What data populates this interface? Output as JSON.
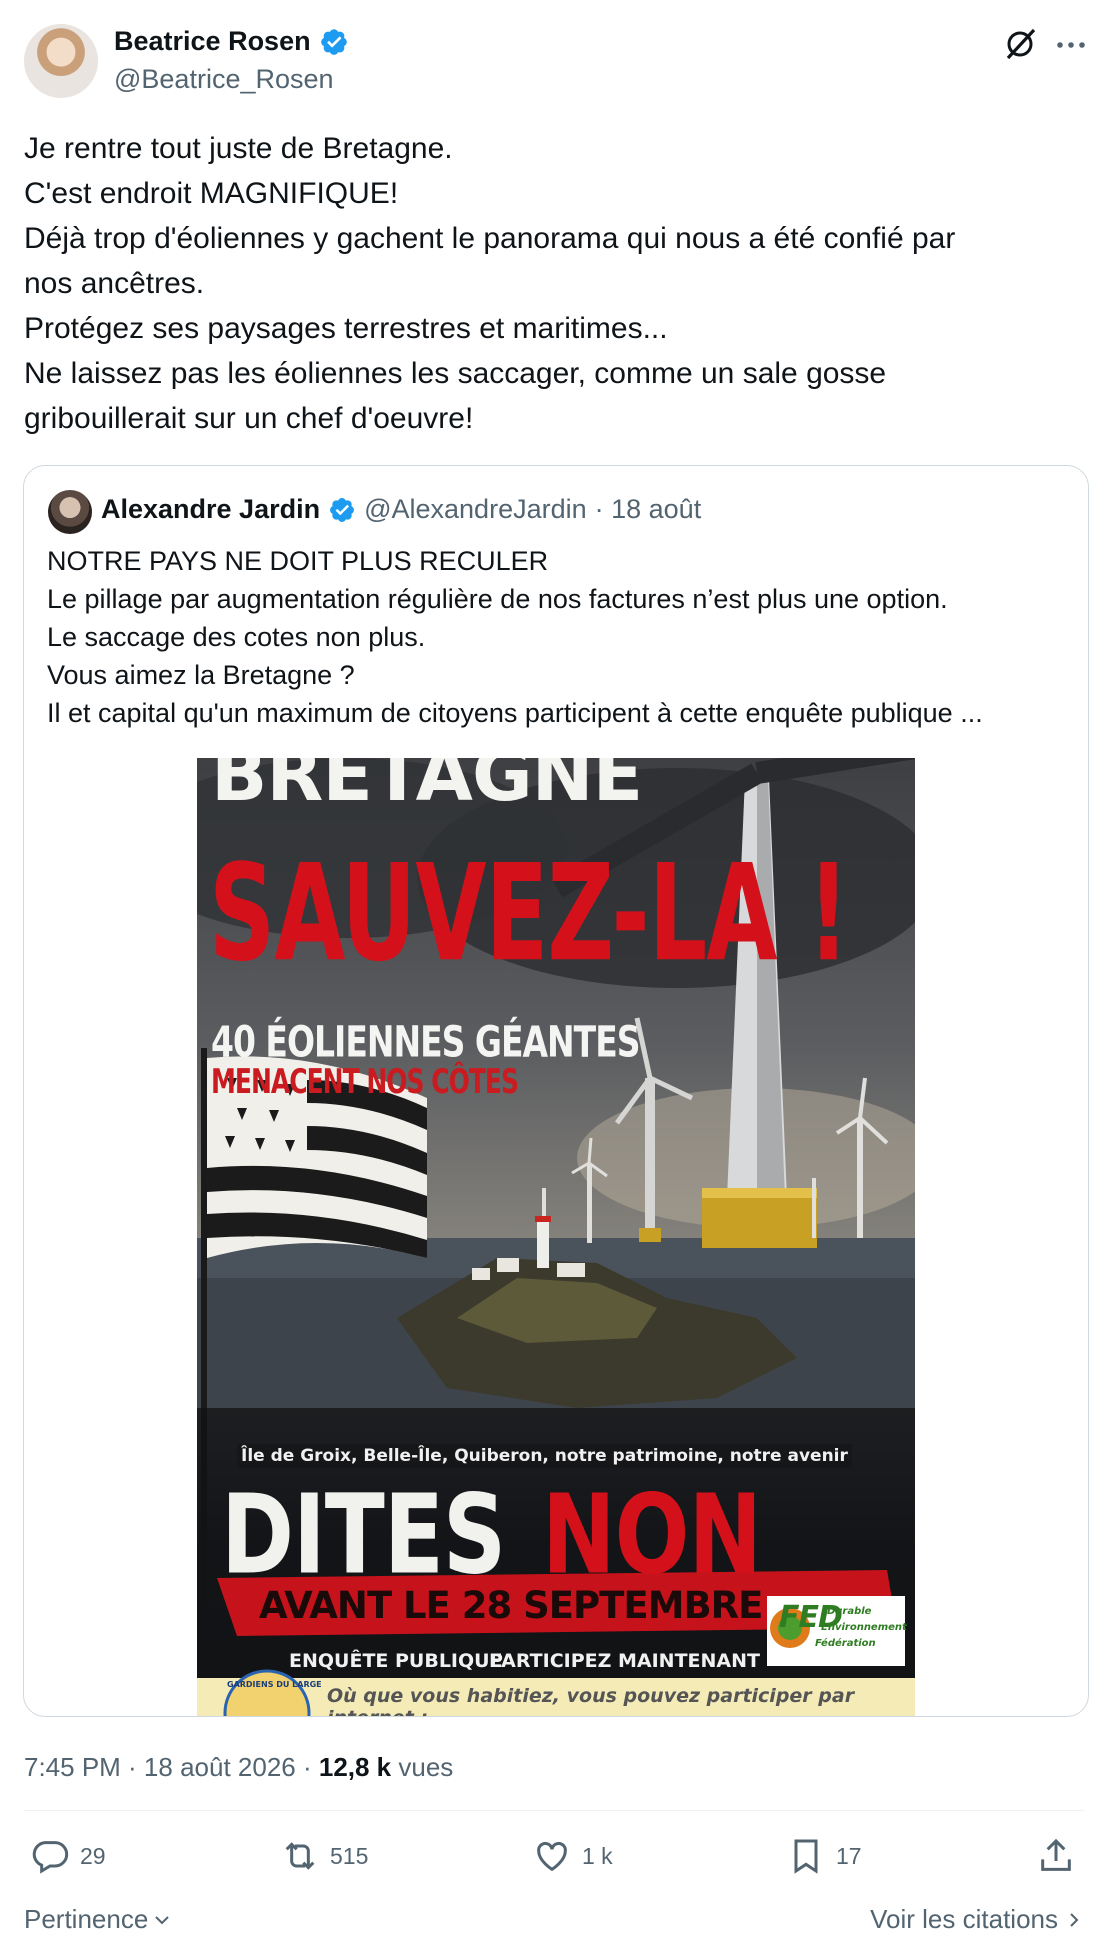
{
  "author": {
    "name": "Beatrice Rosen",
    "handle": "@Beatrice_Rosen",
    "verified_icon": "verified-badge-icon"
  },
  "header_icons": [
    "grok-icon",
    "more-icon"
  ],
  "tweet": {
    "lines": [
      "Je rentre tout juste de Bretagne.",
      "C'est endroit MAGNIFIQUE!",
      "Déjà trop d'éoliennes y gachent le panorama qui nous a été confié par",
      "nos ancêtres.",
      "Protégez ses paysages terrestres et maritimes...",
      "Ne laissez pas les éoliennes les saccager, comme un sale gosse",
      "gribouillerait sur un chef d'oeuvre!"
    ]
  },
  "quote": {
    "name": "Alexandre Jardin",
    "handle": "@AlexandreJardin",
    "date": "· 18 août",
    "lines": [
      "NOTRE PAYS NE DOIT PLUS RECULER",
      "Le pillage par augmentation régulière de nos factures n’est plus une option.",
      "Le saccage des cotes non plus.",
      "Vous aimez la Bretagne ?",
      "Il et capital qu'un maximum de citoyens participent à cette enquête publique ..."
    ],
    "poster": {
      "top_word": "BRETAGNE",
      "headline": "SAUVEZ-LA !",
      "sub1": "40 ÉOLIENNES GÉANTES",
      "sub2": "MENACENT NOS CÔTES",
      "places": "Île de Groix, Belle-Île, Quiberon, notre patrimoine, notre avenir",
      "dites": "DITES",
      "non": "NON",
      "deadline": "AVANT LE 28 SEPTEMBRE",
      "enquete": "ENQUÊTE PUBLIQUE",
      "participez": "PARTICIPEZ MAINTENANT",
      "logo_text_1": "Durable",
      "logo_text_2": "Environnement",
      "logo_text_3": "Fédération",
      "logo_letters": "FED",
      "bottom_band": "Où que vous habitiez, vous pouvez participer par internet :",
      "gardiens": "GARDIENS DU LARGE"
    }
  },
  "meta": {
    "time": "7:45 PM · 18 août 2026 · ",
    "views_count": "12,8 k",
    "views_label": " vues"
  },
  "actions": {
    "replies": "29",
    "reposts": "515",
    "likes": "1 k",
    "bookmarks": "17"
  },
  "bottom": {
    "sort": "Pertinence",
    "quotes_link": "Voir les citations"
  },
  "colors": {
    "verified": "#1d9bf0",
    "poster_red": "#d4111a",
    "text": "#0f1419",
    "muted": "#536471"
  }
}
